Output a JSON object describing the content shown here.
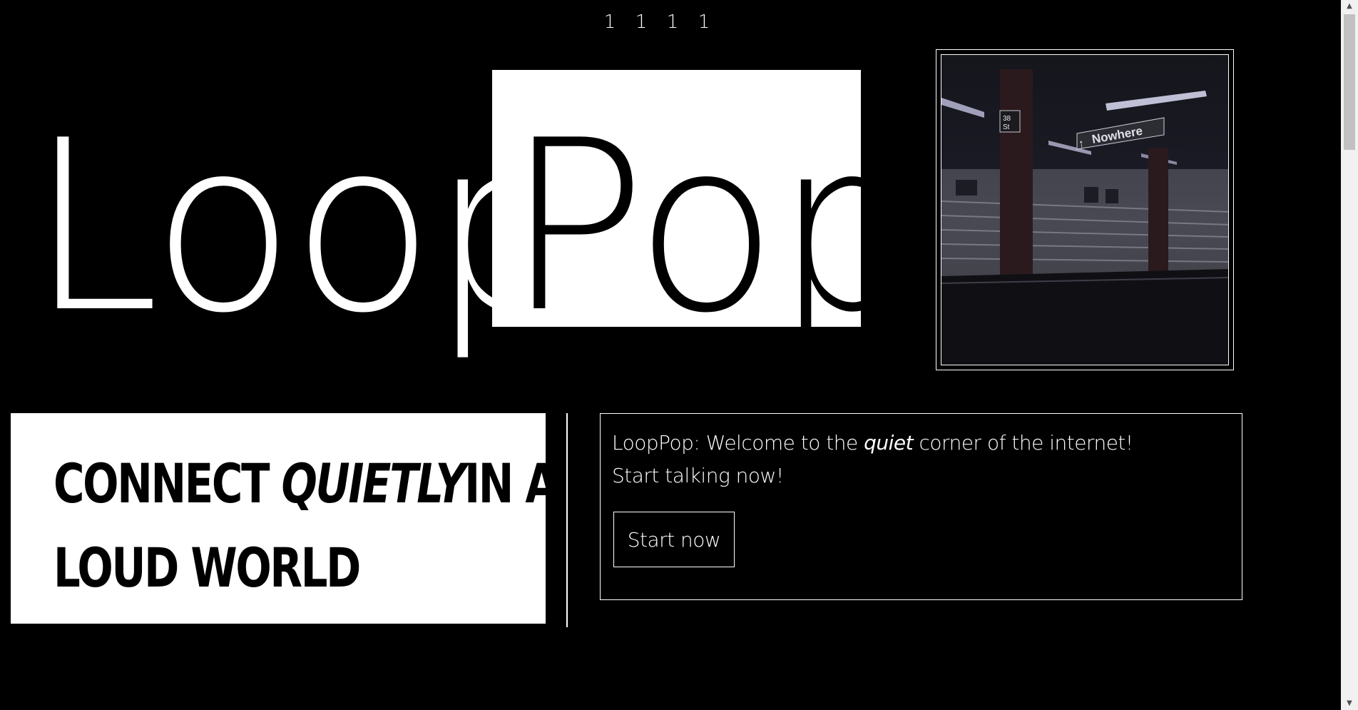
{
  "nav": {
    "items": [
      "1",
      "1",
      "1",
      "1"
    ]
  },
  "logo": {
    "left": "Loop",
    "right": "Pop"
  },
  "photo": {
    "sign_text": "Nowhere",
    "pillar_text": "38 St"
  },
  "headline": {
    "part1": "CONNECT ",
    "emphasis": "QUIETLY",
    "part2": "IN A",
    "line2": "LOUD WORLD"
  },
  "welcome": {
    "prefix": "LoopPop: Welcome to the ",
    "emphasis": "quiet",
    "suffix": " corner of the internet!",
    "line2": "Start talking now!",
    "button_label": "Start now"
  },
  "colors": {
    "background": "#000000",
    "foreground": "#ffffff",
    "scrollbar_track": "#f1f1f1",
    "scrollbar_thumb": "#c1c1c1"
  },
  "icons": {
    "scroll_up": "scroll-up-arrow-icon",
    "scroll_down": "scroll-down-arrow-icon",
    "sign_arrow": "arrow-up-icon"
  }
}
